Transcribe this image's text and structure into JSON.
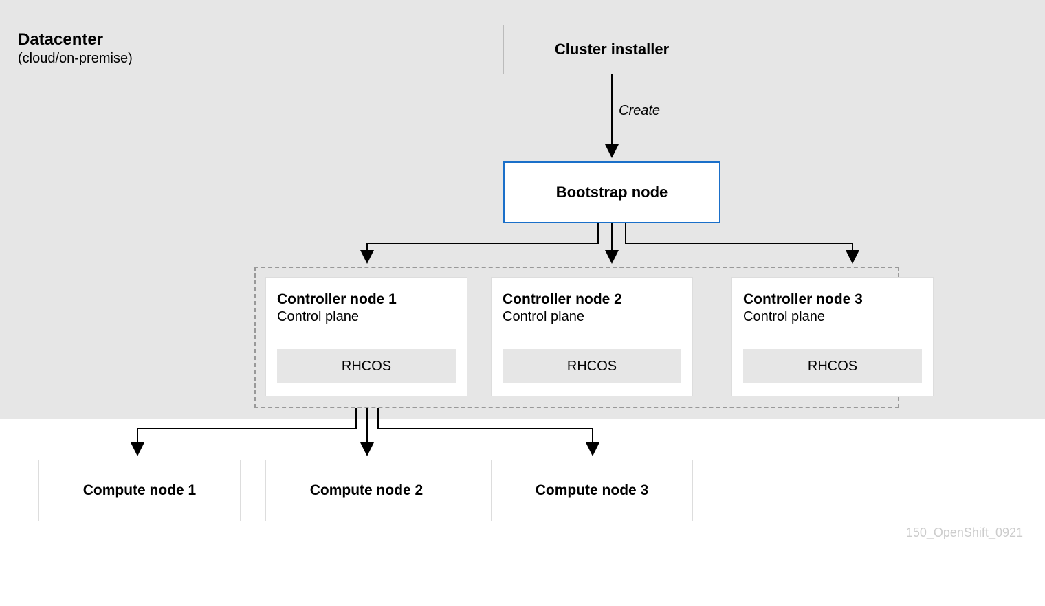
{
  "installer": "Cluster installer",
  "create": "Create",
  "datacenter": {
    "title": "Datacenter",
    "sub": "(cloud/on-premise)"
  },
  "bootstrap": "Bootstrap node",
  "controllers": [
    {
      "title": "Controller node 1",
      "sub": "Control plane",
      "os": "RHCOS"
    },
    {
      "title": "Controller node 2",
      "sub": "Control plane",
      "os": "RHCOS"
    },
    {
      "title": "Controller node 3",
      "sub": "Control plane",
      "os": "RHCOS"
    }
  ],
  "computes": [
    "Compute node 1",
    "Compute node 2",
    "Compute node 3"
  ],
  "watermark": "150_OpenShift_0921"
}
